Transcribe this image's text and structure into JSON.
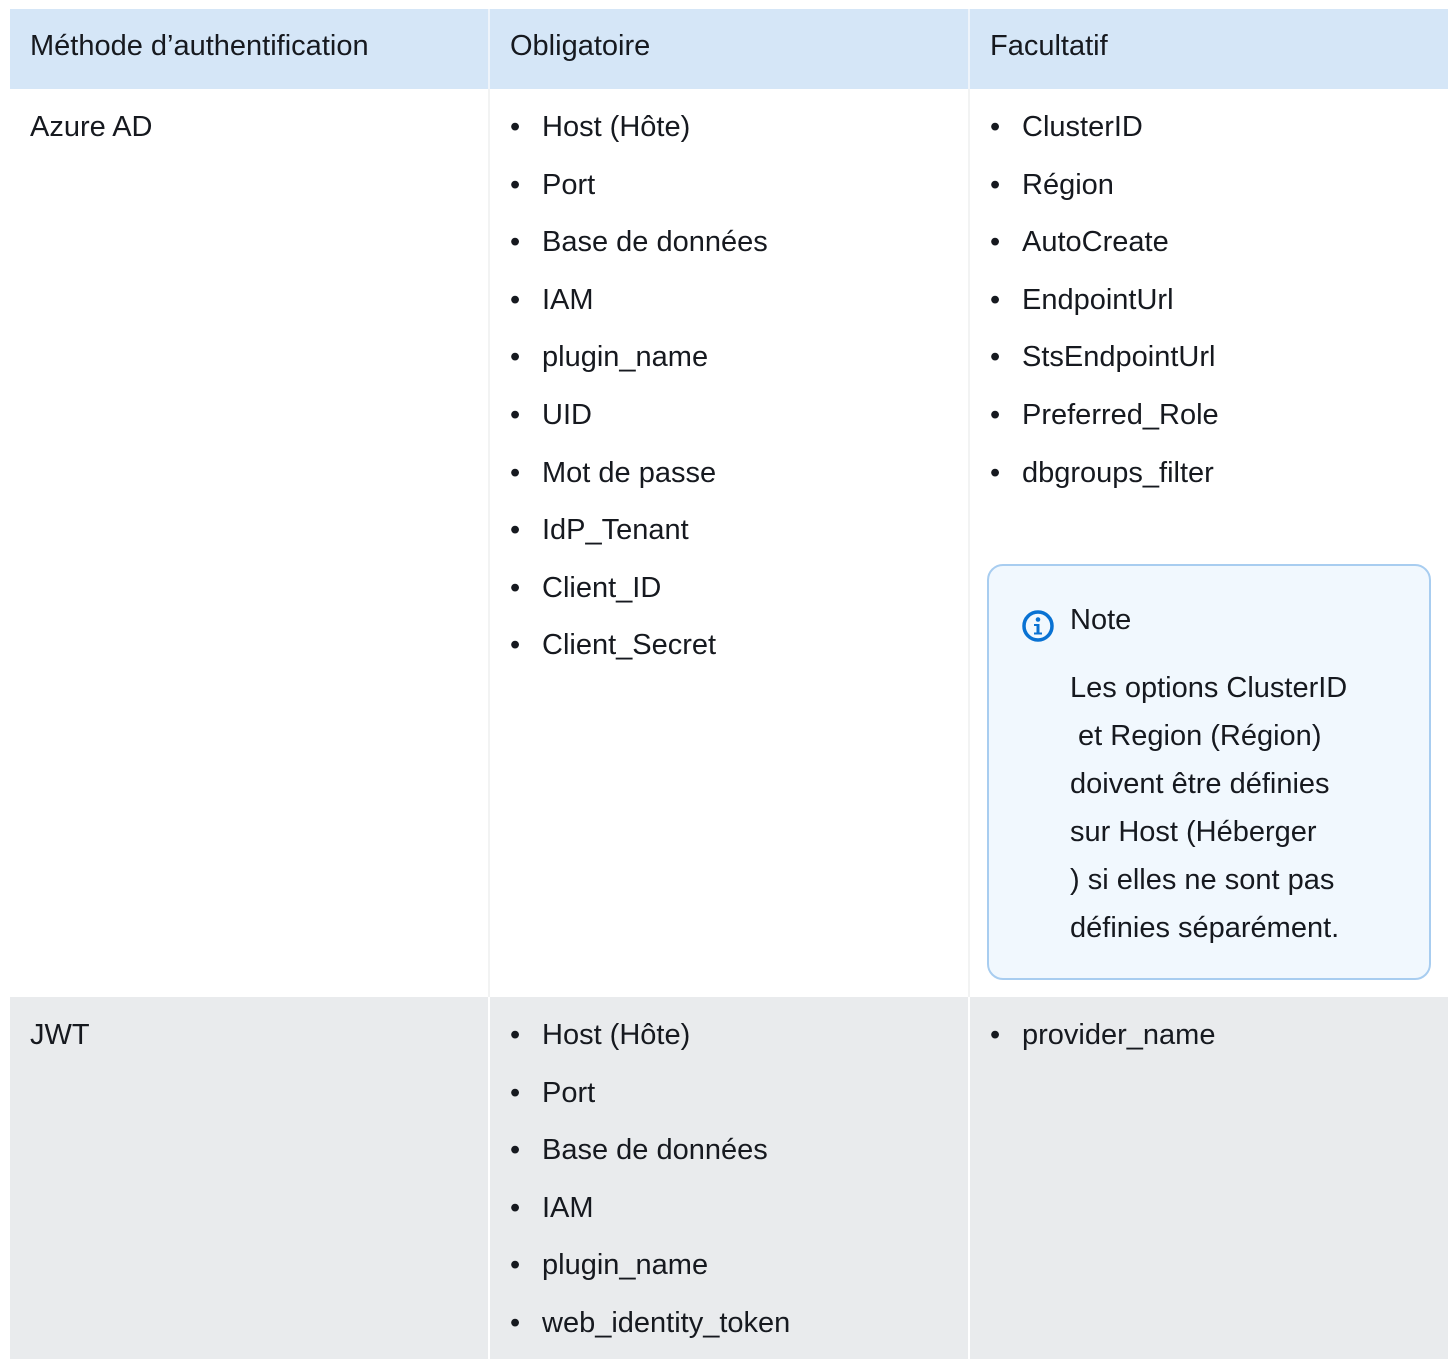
{
  "headers": [
    "Méthode d’authentification",
    "Obligatoire",
    "Facultatif"
  ],
  "rows": [
    {
      "method": "Azure AD",
      "required": [
        "Host (Hôte)",
        "Port",
        "Base de données",
        "IAM",
        "plugin_name",
        "UID",
        "Mot de passe",
        "IdP_Tenant",
        "Client_ID",
        "Client_Secret"
      ],
      "optional": [
        "ClusterID",
        "Région",
        "AutoCreate",
        "EndpointUrl",
        "StsEndpointUrl",
        "Preferred_Role",
        "dbgroups_filter"
      ]
    },
    {
      "method": "JWT",
      "required": [
        "Host (Hôte)",
        "Port",
        "Base de données",
        "IAM",
        "plugin_name",
        "web_identity_token"
      ],
      "optional": [
        "provider_name"
      ]
    }
  ],
  "note": {
    "icon": "info-icon",
    "title": "Note",
    "lines": [
      "Les options ClusterID",
      " et Region (Région)",
      "doivent être définies",
      "sur Host (Héberger",
      ") si elles ne sont pas",
      "définies séparément."
    ]
  },
  "colors": {
    "header_bg": "#d5e6f7",
    "row_alt_bg": "#e9ebed",
    "note_border": "#a8cdf0",
    "note_bg": "#f1f8fe",
    "info_icon": "#0972d3"
  }
}
